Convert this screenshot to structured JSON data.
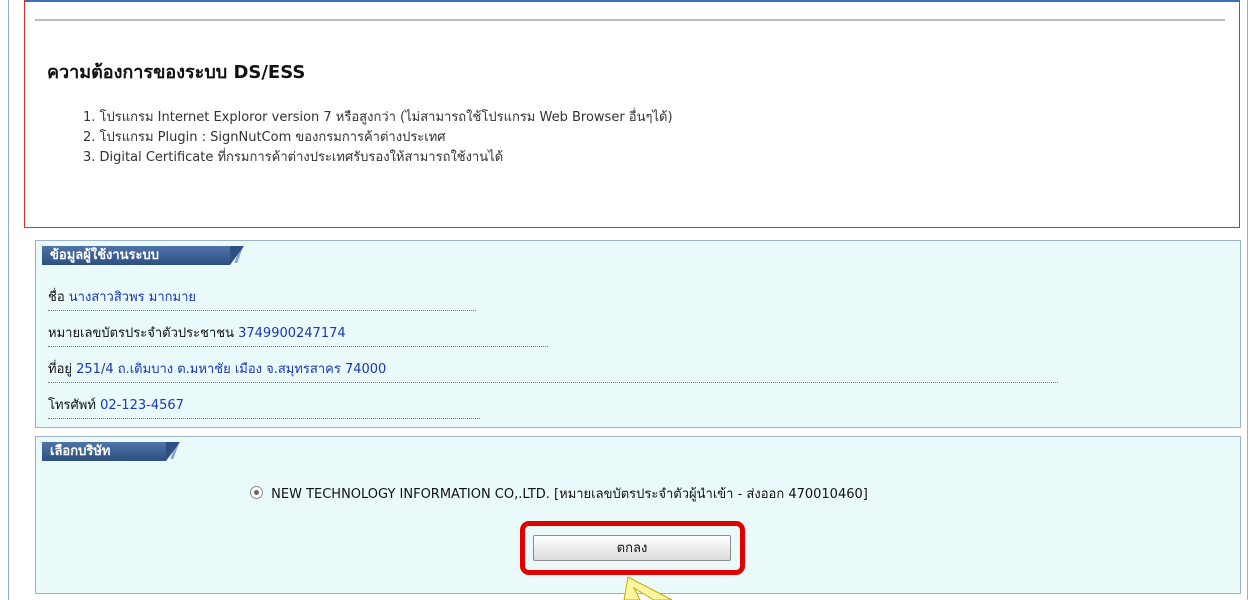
{
  "requirements": {
    "title": "ความต้องการของระบบ DS/ESS",
    "items": [
      "1. โปรแกรม Internet Exploror version 7 หรือสูงกว่า (ไม่สามารถใช้โปรแกรม Web Browser อื่นๆได้)",
      "2. โปรแกรม Plugin : SignNutCom ของกรมการค้าต่างประเทศ",
      "3. Digital Certificate ที่กรมการค้าต่างประเทศรับรองให้สามารถใช้งานได้"
    ]
  },
  "user_info": {
    "header": "ข้อมูลผู้ใช้งานระบบ",
    "name_label": "ชื่อ",
    "name_value": "นางสาวสิวพร มากมาย",
    "id_label": "หมายเลขบัตรประจำตัวประชาชน",
    "id_value": "3749900247174",
    "address_label": "ที่อยู่",
    "address_value": "251/4 ถ.เดิมบาง ต.มหาชัย เมือง จ.สมุทรสาคร 74000",
    "phone_label": "โทรศัพท์",
    "phone_value": "02-123-4567"
  },
  "company": {
    "header": "เลือกบริษัท",
    "option_label": "NEW TECHNOLOGY INFORMATION CO,.LTD. [หมายเลขบัตรประจำตัวผู้นำเข้า - ส่งออก 470010460]",
    "option_selected": true,
    "ok_label": "ตกลง"
  },
  "colors": {
    "panel_bg": "#eafafb",
    "header_bg": "#2d4f82",
    "value_text": "#1a37b5",
    "highlight": "#e00000"
  }
}
